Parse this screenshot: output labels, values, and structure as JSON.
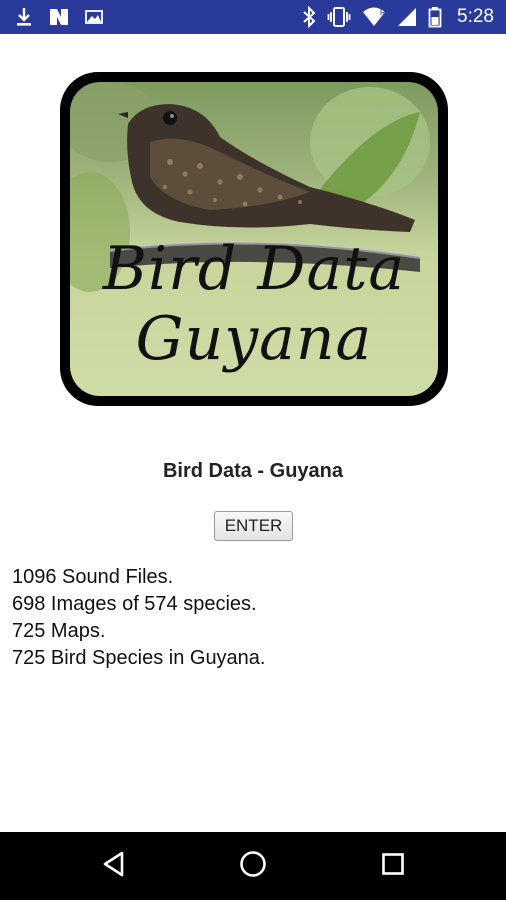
{
  "status_bar": {
    "time": "5:28",
    "left_icons": [
      "download-icon",
      "n-notification-icon",
      "photo-icon"
    ],
    "right_icons": [
      "bluetooth-icon",
      "vibrate-icon",
      "wifi-icon",
      "signal-icon",
      "battery-icon"
    ],
    "background": "#2a3a9b"
  },
  "logo": {
    "line1": "Bird Data",
    "line2": "Guyana",
    "image": "nightjar-bird"
  },
  "main": {
    "heading": "Bird Data - Guyana",
    "enter_button": "ENTER",
    "stats": [
      "1096 Sound Files.",
      "698 Images of 574 species.",
      "725 Maps.",
      "725 Bird Species in Guyana."
    ]
  },
  "nav_bar": {
    "buttons": [
      "back-icon",
      "home-icon",
      "recent-apps-icon"
    ]
  }
}
